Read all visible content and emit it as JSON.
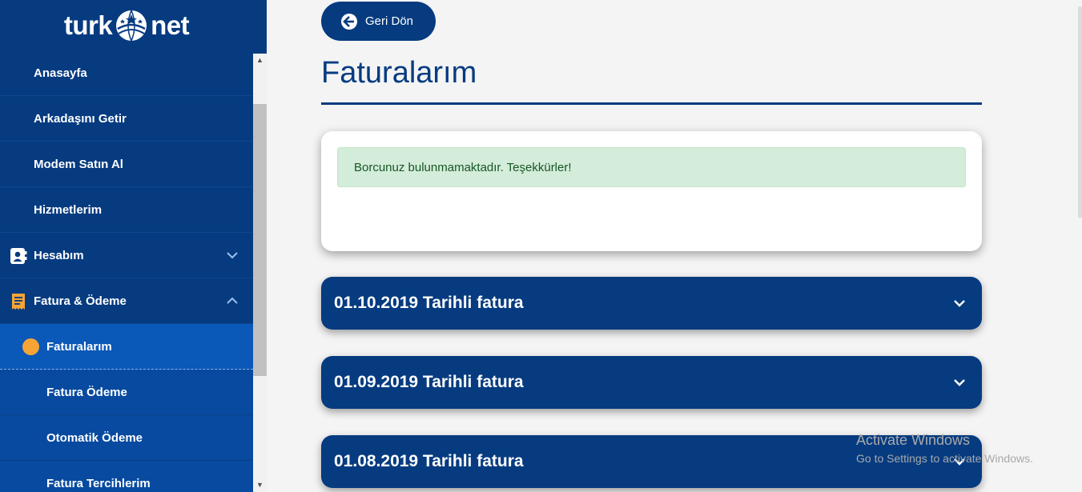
{
  "brand": {
    "logo_left": "turk",
    "logo_right": "net"
  },
  "sidebar": {
    "items": [
      {
        "label": "Anasayfa"
      },
      {
        "label": "Arkadaşını Getir"
      },
      {
        "label": "Modem Satın Al"
      },
      {
        "label": "Hizmetlerim"
      },
      {
        "label": "Hesabım",
        "icon": "account-icon",
        "state": "collapsed"
      },
      {
        "label": "Fatura & Ödeme",
        "icon": "receipt-icon",
        "state": "expanded"
      },
      {
        "label": "Faturalarım",
        "active": true
      },
      {
        "label": "Fatura Ödeme"
      },
      {
        "label": "Otomatik Ödeme"
      },
      {
        "label": "Fatura Tercihlerim"
      }
    ]
  },
  "main": {
    "back_label": "Geri Dön",
    "title": "Faturalarım",
    "alert": "Borcunuz bulunmamaktadır. Teşekkürler!",
    "invoices": [
      {
        "label": "01.10.2019 Tarihli fatura"
      },
      {
        "label": "01.09.2019 Tarihli fatura"
      },
      {
        "label": "01.08.2019 Tarihli fatura"
      }
    ]
  },
  "watermark": {
    "line1": "Activate Windows",
    "line2": "Go to Settings to activate Windows."
  },
  "colors": {
    "brand_navy": "#063b80",
    "active_blue": "#0a58b8",
    "accent_orange": "#f7a436",
    "alert_green_bg": "#d4ecda",
    "alert_green_text": "#155724"
  }
}
